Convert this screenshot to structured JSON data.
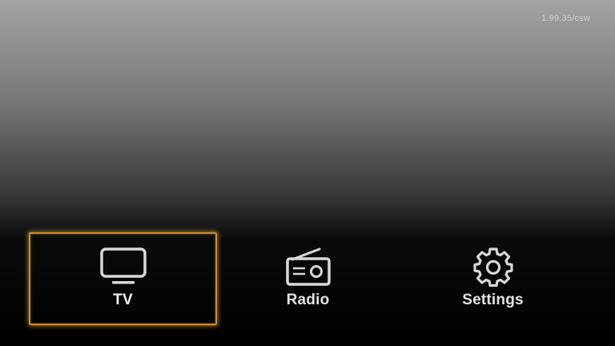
{
  "app": {
    "version": "1.99.35/csw"
  },
  "menu": {
    "items": [
      {
        "label": "TV",
        "icon": "tv-icon",
        "focused": true
      },
      {
        "label": "Radio",
        "icon": "radio-icon",
        "focused": false
      },
      {
        "label": "Settings",
        "icon": "gear-icon",
        "focused": false
      }
    ]
  },
  "colors": {
    "focus_border": "#c9902c",
    "icon": "#d8d8d8",
    "label": "#e4e4e4"
  }
}
